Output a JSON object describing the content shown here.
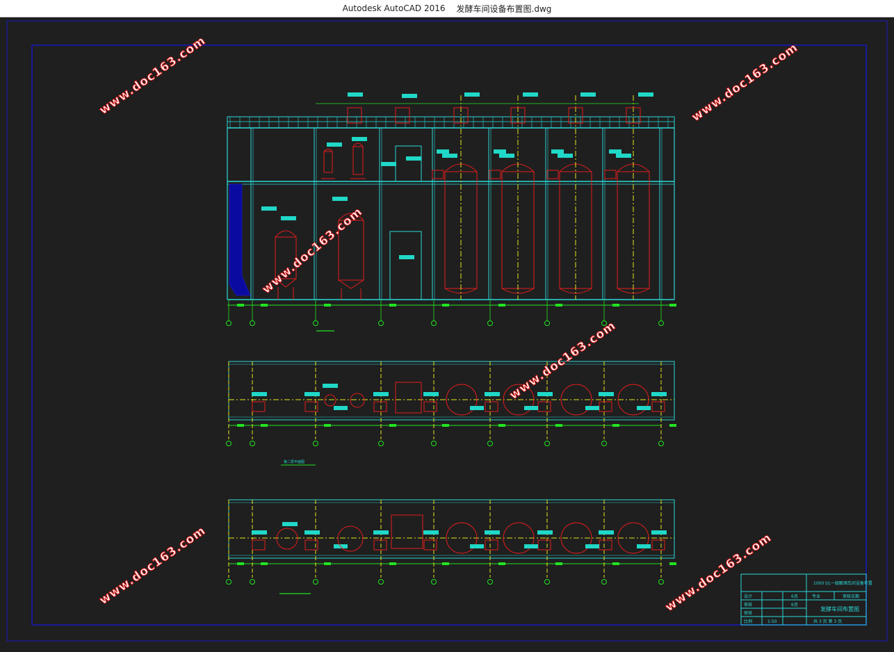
{
  "window": {
    "app_name": "Autodesk AutoCAD 2016",
    "file_name": "发酵车间设备布置图.dwg"
  },
  "drawing": {
    "colors": {
      "background": "#1f1f1f",
      "frame": "#1a1aa8",
      "structure": "#2bd8d8",
      "grid": "#22e422",
      "equipment": "#e41c1c",
      "centerline": "#e6e61e",
      "label": "#20d8c8",
      "column_fill": "#0a0aa0",
      "watermark": "#d81818"
    },
    "watermarks": [
      "www.doc163.com",
      "www.doc163.com",
      "www.doc163.com",
      "www.doc163.com",
      "www.doc163.com",
      "www.doc163.com",
      "www.doc163.com"
    ],
    "plan_note": "第二层平面图",
    "title_block": {
      "project": "1000 t/L一级酿酒车间设备布置",
      "drawing_name": "发酵车间布置图",
      "scale": "1:50",
      "rows": [
        {
          "label": "设计",
          "value": "6月"
        },
        {
          "label": "审核",
          "value": "6月"
        },
        {
          "label": "审核",
          "value": ""
        },
        {
          "label": "比例",
          "value": "1:50"
        }
      ],
      "sheet": "共 3 页  第 3 页",
      "right_top_a": "专业",
      "right_top_b": "审核日期"
    }
  }
}
